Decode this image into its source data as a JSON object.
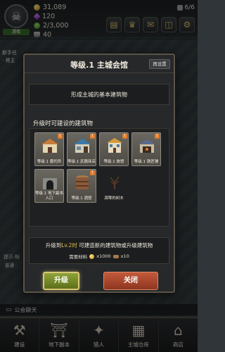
{
  "top_bar": {
    "resources": [
      {
        "icon": "gold-coin-icon",
        "value": "31,089",
        "color": "#f2c14a"
      },
      {
        "icon": "gem-icon",
        "value": "120",
        "color": "#b45cf0"
      },
      {
        "icon": "population-icon",
        "value": "2/3,000",
        "color": "#7cc24a"
      },
      {
        "icon": "shield-icon",
        "value": "40",
        "color": "#a8a8a8"
      }
    ],
    "avatar_name": "游戏",
    "day_counter": "6/6",
    "top_icons": [
      "book-icon",
      "trophy-icon",
      "mail-icon",
      "gift-icon",
      "gear-icon"
    ]
  },
  "side": {
    "line1": "新手任",
    "line2": "· 将主",
    "sub1": "提示·帐",
    "sub2": "普通"
  },
  "modal": {
    "title": "等级.1 主城会馆",
    "preview_button": "再设置",
    "description": "形成主城的基本建筑物",
    "unlock_title": "升级时可建设的建筑物",
    "buildings": [
      {
        "name": "等级.1 委托所",
        "badge": "1",
        "dim": false,
        "color": "#c97a3a"
      },
      {
        "name": "等级.1 武器商店",
        "badge": "1",
        "dim": false,
        "color": "#3a7aa8"
      },
      {
        "name": "等级.1 旅馆",
        "badge": "1",
        "dim": false,
        "color": "#d49a3a"
      },
      {
        "name": "等级.1 铁匠铺",
        "badge": "1",
        "dim": false,
        "color": "#5a6a8a"
      },
      {
        "name": "等级.1 地下副本入口",
        "badge": "",
        "dim": false,
        "color": "#6a6a6a"
      },
      {
        "name": "等级.1 酒馆",
        "badge": "1",
        "dim": false,
        "color": "#8a5a3a"
      },
      {
        "name": "凋零的树木",
        "badge": "",
        "dim": true,
        "color": "#5a3a2a"
      }
    ],
    "upgrade_text_prefix": "升级到",
    "upgrade_level": "Lv.2时",
    "upgrade_text_suffix": " 可建造新的建筑物或升级建筑物",
    "cost_label": "需要材料",
    "cost_gold": "x1000",
    "cost_wood": "x10",
    "upgrade_button": "升级",
    "close_button": "关闭"
  },
  "chat": {
    "label": "公会聊天"
  },
  "bottom_nav": [
    {
      "label": "建设",
      "icon": "hammer-icon"
    },
    {
      "label": "地下副本",
      "icon": "dungeon-gate-icon"
    },
    {
      "label": "猎人",
      "icon": "hunter-emblem-icon"
    },
    {
      "label": "主城仓库",
      "icon": "warehouse-icon"
    },
    {
      "label": "商店",
      "icon": "shop-icon"
    }
  ]
}
